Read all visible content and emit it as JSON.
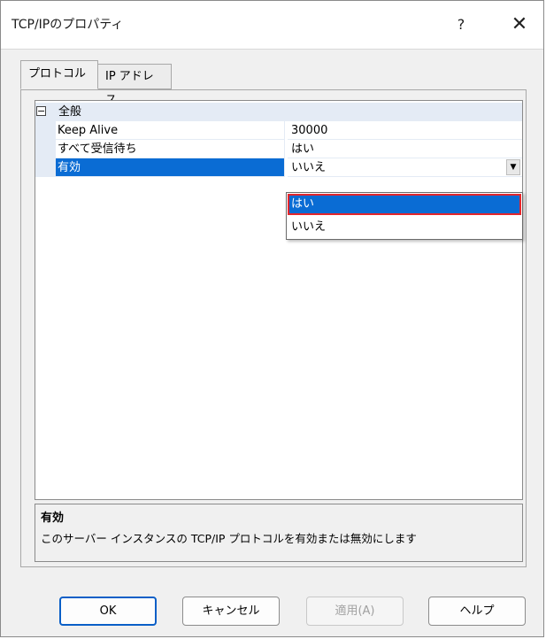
{
  "window": {
    "title": "TCP/IPのプロパティ",
    "help_glyph": "?",
    "close_glyph": "✕"
  },
  "tabs": [
    {
      "label": "プロトコル",
      "active": true
    },
    {
      "label": "IP アドレス",
      "active": false
    }
  ],
  "grid": {
    "category": {
      "label": "全般",
      "expander": "⊟"
    },
    "properties": [
      {
        "name": "Keep Alive",
        "value": "30000"
      },
      {
        "name": "すべて受信待ち",
        "value": "はい"
      },
      {
        "name": "有効",
        "value": "いいえ",
        "selected": true,
        "dropdown_icon": "▼"
      }
    ],
    "dropdown": {
      "options": [
        "はい",
        "いいえ"
      ],
      "highlighted": "はい"
    }
  },
  "description": {
    "title": "有効",
    "text": "このサーバー インスタンスの TCP/IP プロトコルを有効または無効にします"
  },
  "buttons": {
    "ok": "OK",
    "cancel": "キャンセル",
    "apply": "適用(A)",
    "help": "ヘルプ"
  },
  "colors": {
    "selection": "#0a6cd4",
    "highlight_border": "#e3262d",
    "category_band": "#e4ebf5"
  }
}
